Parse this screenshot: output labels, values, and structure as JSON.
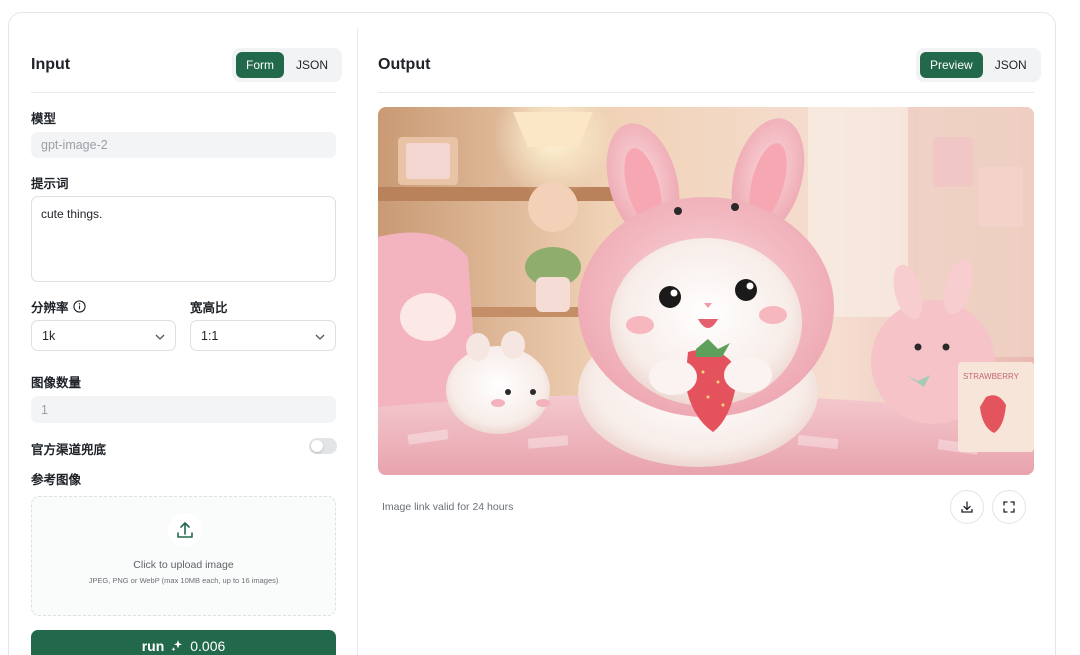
{
  "input": {
    "title": "Input",
    "view_toggle": {
      "form": "Form",
      "json": "JSON",
      "active": "Form"
    },
    "model": {
      "label": "模型",
      "value": "gpt-image-2"
    },
    "prompt": {
      "label": "提示词",
      "value": "cute things."
    },
    "resolution": {
      "label": "分辨率",
      "value": "1k"
    },
    "aspect_ratio": {
      "label": "宽高比",
      "value": "1:1"
    },
    "image_count": {
      "label": "图像数量",
      "value": "1"
    },
    "fallback": {
      "label": "官方渠道兜底",
      "enabled": false
    },
    "reference": {
      "label": "参考图像",
      "upload_title": "Click to upload image",
      "upload_hint": "JPEG, PNG or WebP (max 10MB each, up to 16 images)"
    },
    "run": {
      "label": "run",
      "cost": "0.006"
    }
  },
  "output": {
    "title": "Output",
    "view_toggle": {
      "preview": "Preview",
      "json": "JSON",
      "active": "Preview"
    },
    "image_alt": "cute things.",
    "note": "Image link valid for 24 hours",
    "strawberry_box_text": "STRAWBERRY"
  },
  "icons": {
    "info": "info-icon",
    "chevron": "chevron-down-icon",
    "upload": "upload-icon",
    "sparkle": "sparkle-icon",
    "download": "download-icon",
    "fullscreen": "fullscreen-icon"
  },
  "colors": {
    "accent": "#22684b",
    "border": "#e3e5e8"
  }
}
